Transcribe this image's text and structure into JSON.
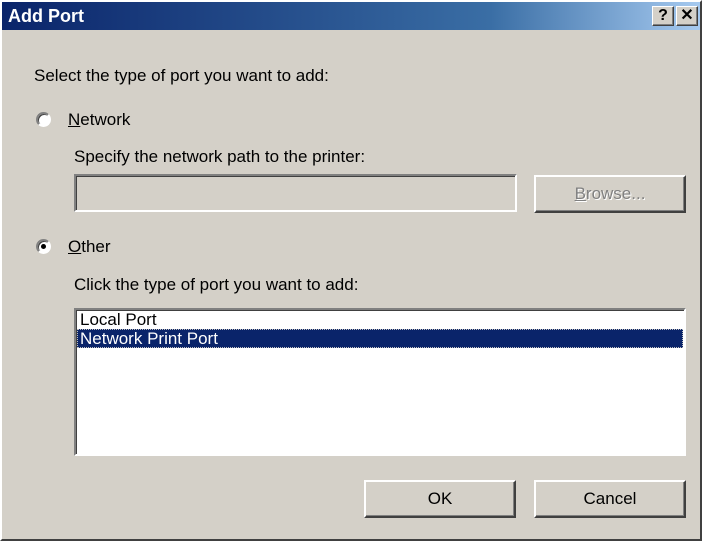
{
  "window": {
    "title": "Add Port",
    "help_glyph": "?",
    "close_glyph": "✕"
  },
  "prompt": "Select the type of port you want to add:",
  "network_option": {
    "label_accel": "N",
    "label_rest": "etwork",
    "selected": false,
    "instruction": "Specify the network path to the printer:",
    "path_value": "",
    "browse_accel": "B",
    "browse_rest": "rowse...",
    "browse_enabled": false
  },
  "other_option": {
    "label_accel": "O",
    "label_rest": "ther",
    "selected": true,
    "instruction": "Click the type of port you want to add:"
  },
  "port_types": [
    {
      "label": "Local Port",
      "selected": false
    },
    {
      "label": "Network Print Port",
      "selected": true
    }
  ],
  "buttons": {
    "ok": "OK",
    "cancel": "Cancel"
  },
  "colors": {
    "dialog_face": "#d4d0c8",
    "titlebar_start": "#0a246a",
    "selection": "#0a246a",
    "disabled_text": "#808080"
  }
}
